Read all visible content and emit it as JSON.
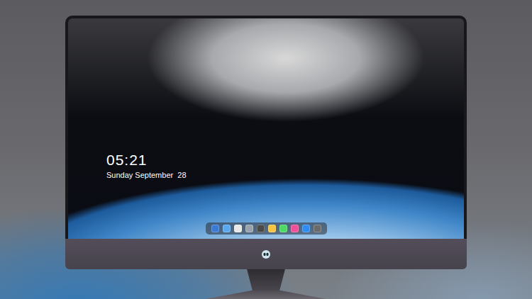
{
  "clock": {
    "time": "05:21",
    "date": "Sunday September  28"
  },
  "dock": {
    "items": [
      {
        "color": "#3a7bd5"
      },
      {
        "color": "#5aa8f0"
      },
      {
        "color": "#e8e8e8"
      },
      {
        "color": "#9aa3ad"
      },
      {
        "color": "#4a4a4a"
      },
      {
        "color": "#f5c542"
      },
      {
        "color": "#4cd964"
      },
      {
        "color": "#f0509a"
      },
      {
        "color": "#2f8cf0"
      },
      {
        "color": "#6b6b6b"
      }
    ]
  }
}
